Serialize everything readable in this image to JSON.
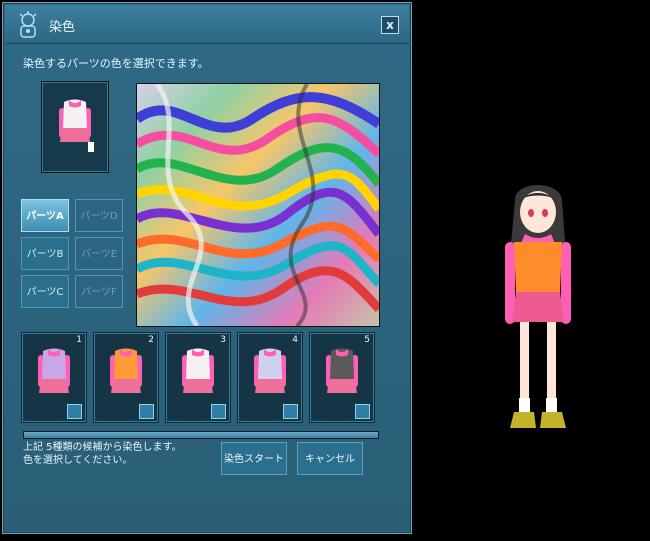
{
  "window": {
    "title": "染色",
    "close_label": "x"
  },
  "instruction": "染色するパーツの色を選択できます。",
  "parts": [
    {
      "label": "パーツA"
    },
    {
      "label": "パーツD"
    },
    {
      "label": "パーツB"
    },
    {
      "label": "パーツE"
    },
    {
      "label": "パーツC"
    },
    {
      "label": "パーツF"
    }
  ],
  "candidates": [
    {
      "num": "1",
      "body": "#c9a6e6"
    },
    {
      "num": "2",
      "body": "#ff9a38"
    },
    {
      "num": "3",
      "body": "#f7f0f2"
    },
    {
      "num": "4",
      "body": "#cfd2ef"
    },
    {
      "num": "5",
      "body": "#5a5a5a"
    }
  ],
  "progress": 1.0,
  "message": {
    "line1": "上記 5種類の候補から染色します。",
    "line2": "色を選択してください。"
  },
  "buttons": {
    "start": "染色スタート",
    "cancel": "キャンセル"
  },
  "colors": {
    "panel": "#2d6783",
    "accent": "#4e97b6",
    "outfit": "#ff5fb4"
  }
}
